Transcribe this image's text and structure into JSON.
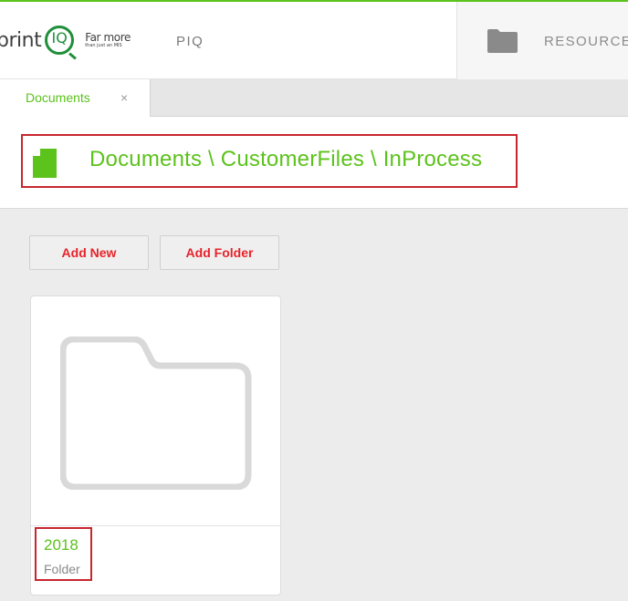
{
  "brand": {
    "logo_word": "print",
    "logo_badge": "IQ",
    "tagline_main": "Far more",
    "tagline_sub": "than just an MIS",
    "accent_color": "#5cc21c",
    "highlight_color": "#c8262d"
  },
  "nav": {
    "items": [
      {
        "label": "PIQ"
      },
      {
        "label": "RESOURCES",
        "icon": "folder-icon"
      }
    ]
  },
  "tabs": [
    {
      "label": "Documents",
      "close_glyph": "×"
    }
  ],
  "breadcrumb": {
    "icon": "document-icon",
    "path": "Documents \\ CustomerFiles \\ InProcess"
  },
  "toolbar": {
    "add_new_label": "Add New",
    "add_folder_label": "Add Folder",
    "button_text_color": "#e8232a"
  },
  "items": [
    {
      "name": "2018",
      "type": "Folder",
      "icon": "folder-icon"
    }
  ]
}
